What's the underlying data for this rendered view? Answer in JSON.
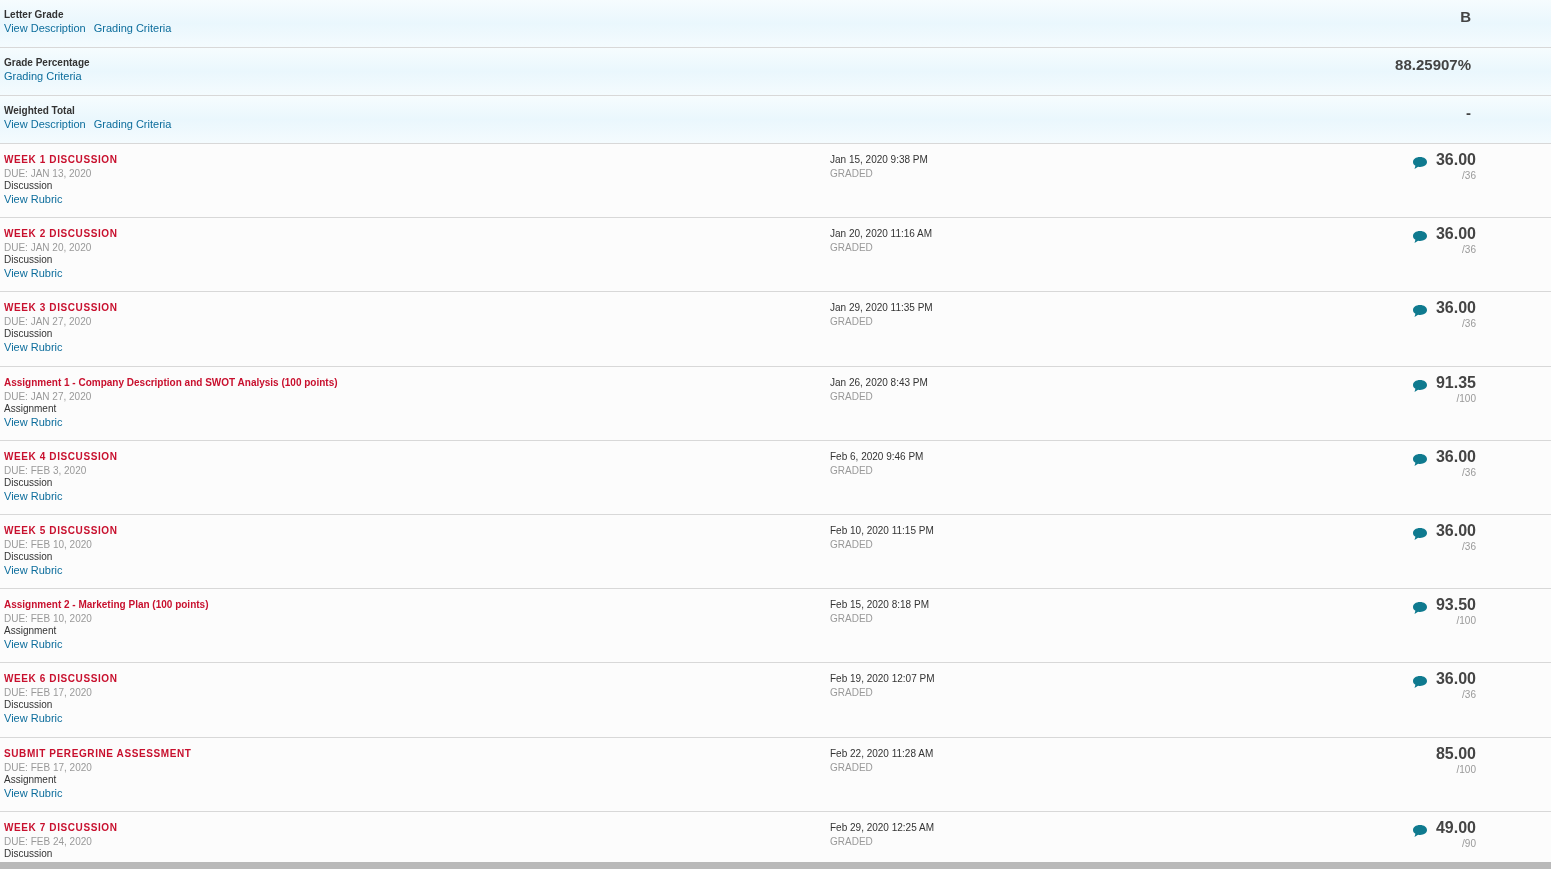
{
  "summary": [
    {
      "label": "Letter Grade",
      "links": [
        "View Description",
        "Grading Criteria"
      ],
      "value": "B"
    },
    {
      "label": "Grade Percentage",
      "links": [
        "Grading Criteria"
      ],
      "value": "88.25907%"
    },
    {
      "label": "Weighted Total",
      "links": [
        "View Description",
        "Grading Criteria"
      ],
      "value": "-"
    }
  ],
  "items": [
    {
      "title": "WEEK 1 DISCUSSION",
      "caps": true,
      "due": "DUE: JAN 13, 2020",
      "type": "Discussion",
      "link": "View Rubric",
      "date": "Jan 15, 2020 9:38 PM",
      "status": "GRADED",
      "feedback": true,
      "score": "36.00",
      "out_of": "/36"
    },
    {
      "title": "WEEK 2 DISCUSSION",
      "caps": true,
      "due": "DUE: JAN 20, 2020",
      "type": "Discussion",
      "link": "View Rubric",
      "date": "Jan 20, 2020 11:16 AM",
      "status": "GRADED",
      "feedback": true,
      "score": "36.00",
      "out_of": "/36"
    },
    {
      "title": "WEEK 3 DISCUSSION",
      "caps": true,
      "due": "DUE: JAN 27, 2020",
      "type": "Discussion",
      "link": "View Rubric",
      "date": "Jan 29, 2020 11:35 PM",
      "status": "GRADED",
      "feedback": true,
      "score": "36.00",
      "out_of": "/36"
    },
    {
      "title": "Assignment 1 - Company Description and SWOT Analysis (100 points)",
      "caps": false,
      "due": "DUE: JAN 27, 2020",
      "type": "Assignment",
      "link": "View Rubric",
      "date": "Jan 26, 2020 8:43 PM",
      "status": "GRADED",
      "feedback": true,
      "score": "91.35",
      "out_of": "/100"
    },
    {
      "title": "WEEK 4 DISCUSSION",
      "caps": true,
      "due": "DUE: FEB 3, 2020",
      "type": "Discussion",
      "link": "View Rubric",
      "date": "Feb 6, 2020 9:46 PM",
      "status": "GRADED",
      "feedback": true,
      "score": "36.00",
      "out_of": "/36"
    },
    {
      "title": "WEEK 5 DISCUSSION",
      "caps": true,
      "due": "DUE: FEB 10, 2020",
      "type": "Discussion",
      "link": "View Rubric",
      "date": "Feb 10, 2020 11:15 PM",
      "status": "GRADED",
      "feedback": true,
      "score": "36.00",
      "out_of": "/36"
    },
    {
      "title": "Assignment 2 - Marketing Plan (100 points)",
      "caps": false,
      "due": "DUE: FEB 10, 2020",
      "type": "Assignment",
      "link": "View Rubric",
      "date": "Feb 15, 2020 8:18 PM",
      "status": "GRADED",
      "feedback": true,
      "score": "93.50",
      "out_of": "/100"
    },
    {
      "title": "WEEK 6 DISCUSSION",
      "caps": true,
      "due": "DUE: FEB 17, 2020",
      "type": "Discussion",
      "link": "View Rubric",
      "date": "Feb 19, 2020 12:07 PM",
      "status": "GRADED",
      "feedback": true,
      "score": "36.00",
      "out_of": "/36"
    },
    {
      "title": "SUBMIT PEREGRINE ASSESSMENT",
      "caps": true,
      "due": "DUE: FEB 17, 2020",
      "type": "Assignment",
      "link": "View Rubric",
      "date": "Feb 22, 2020 11:28 AM",
      "status": "GRADED",
      "feedback": false,
      "score": "85.00",
      "out_of": "/100"
    },
    {
      "title": "WEEK 7 DISCUSSION",
      "caps": true,
      "due": "DUE: FEB 24, 2020",
      "type": "Discussion",
      "date": "Feb 29, 2020 12:25 AM",
      "status": "GRADED",
      "feedback": true,
      "score": "49.00",
      "out_of": "/90"
    }
  ]
}
